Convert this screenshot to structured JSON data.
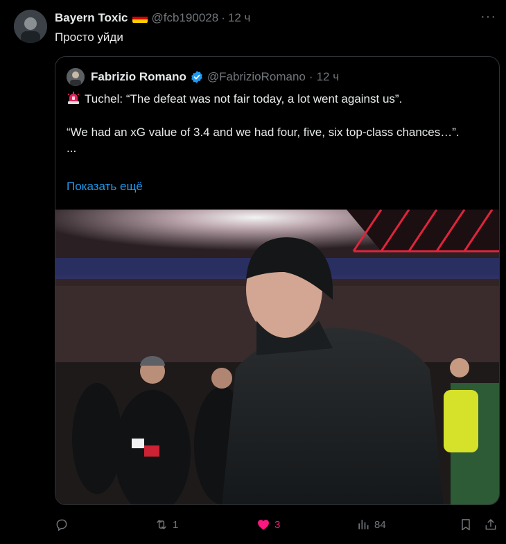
{
  "post": {
    "author_name": "Bayern Toxic",
    "author_handle": "@fcb190028",
    "separator": "·",
    "time": "12 ч",
    "text": "Просто уйди"
  },
  "quote": {
    "author_name": "Fabrizio Romano",
    "author_handle": "@FabrizioRomano",
    "separator": "·",
    "time": "12 ч",
    "line1": "Tuchel: “The defeat was not fair today, a lot went against us”.",
    "line2": "“We had an xG value of 3.4 and we had four, five, six top-class chances…”.",
    "line3": "...",
    "show_more": "Показать ещё",
    "icons": [
      "siren-icon",
      "verified-badge-icon"
    ]
  },
  "actions": {
    "replies": "",
    "reposts": "1",
    "likes": "3",
    "views": "84"
  },
  "colors": {
    "background": "#000000",
    "text": "#e7e9ea",
    "muted": "#71767b",
    "link": "#1d9bf0",
    "like": "#f91880",
    "border": "#2f3336"
  }
}
